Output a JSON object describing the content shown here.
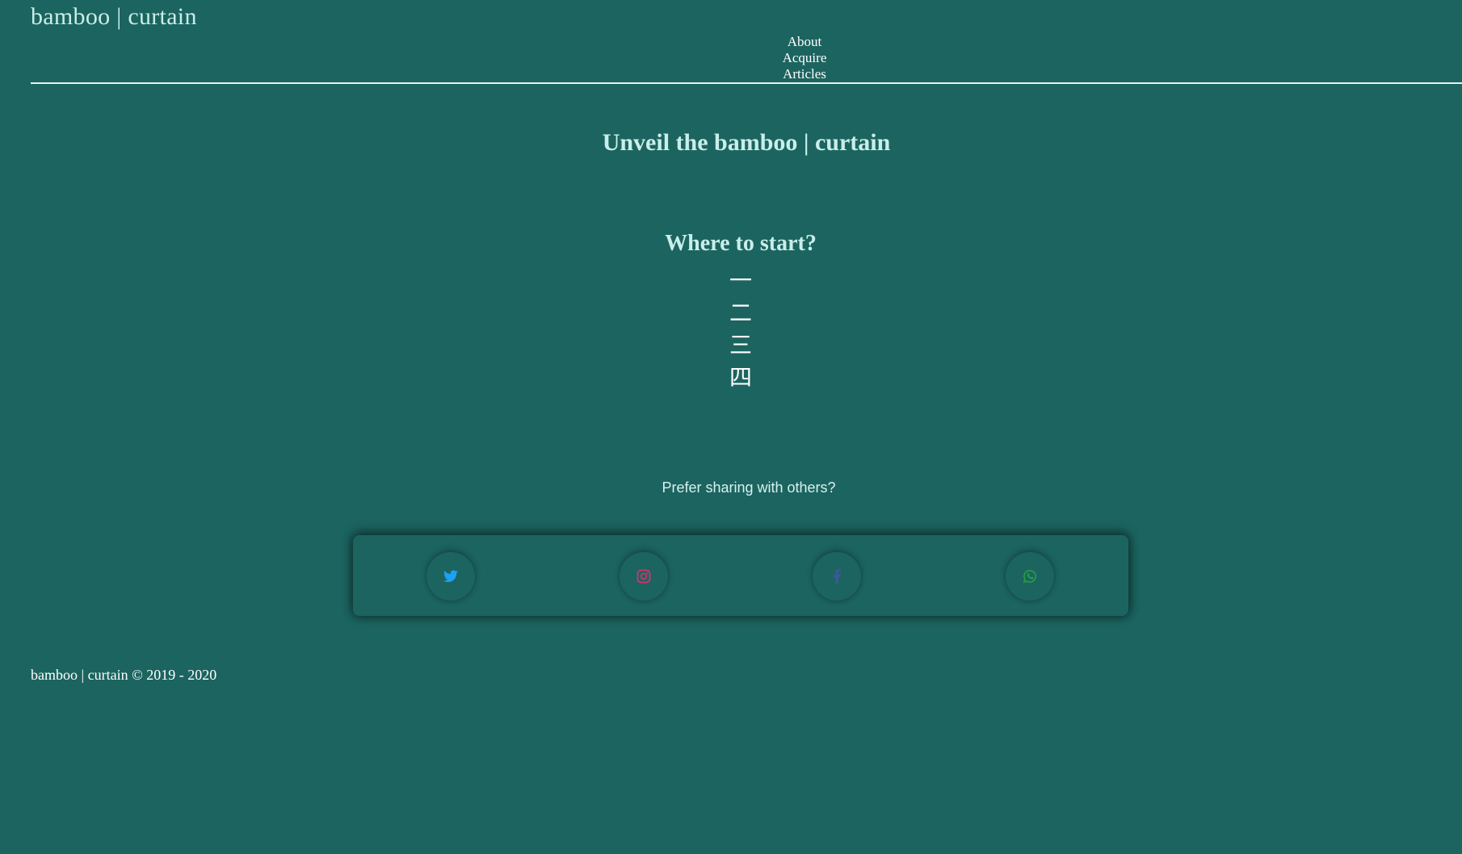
{
  "header": {
    "brand": "bamboo | curtain",
    "nav": [
      "About",
      "Acquire",
      "Articles"
    ]
  },
  "hero": {
    "title": "Unveil the bamboo | curtain"
  },
  "start": {
    "title": "Where to start?",
    "chapters": [
      "一",
      "二",
      "三",
      "四"
    ]
  },
  "share": {
    "prompt": "Prefer sharing with others?",
    "buttons": [
      {
        "icon": "twitter-icon",
        "color": "#1da1f2"
      },
      {
        "icon": "instagram-icon",
        "color": "#e1306c"
      },
      {
        "icon": "facebook-icon",
        "color": "#3b5998"
      },
      {
        "icon": "whatsapp-icon",
        "color": "#25a244"
      }
    ]
  },
  "footer": {
    "text": "bamboo | curtain © 2019 - 2020"
  },
  "colors": {
    "background": "#1c6460",
    "heading": "#c9eeea"
  }
}
